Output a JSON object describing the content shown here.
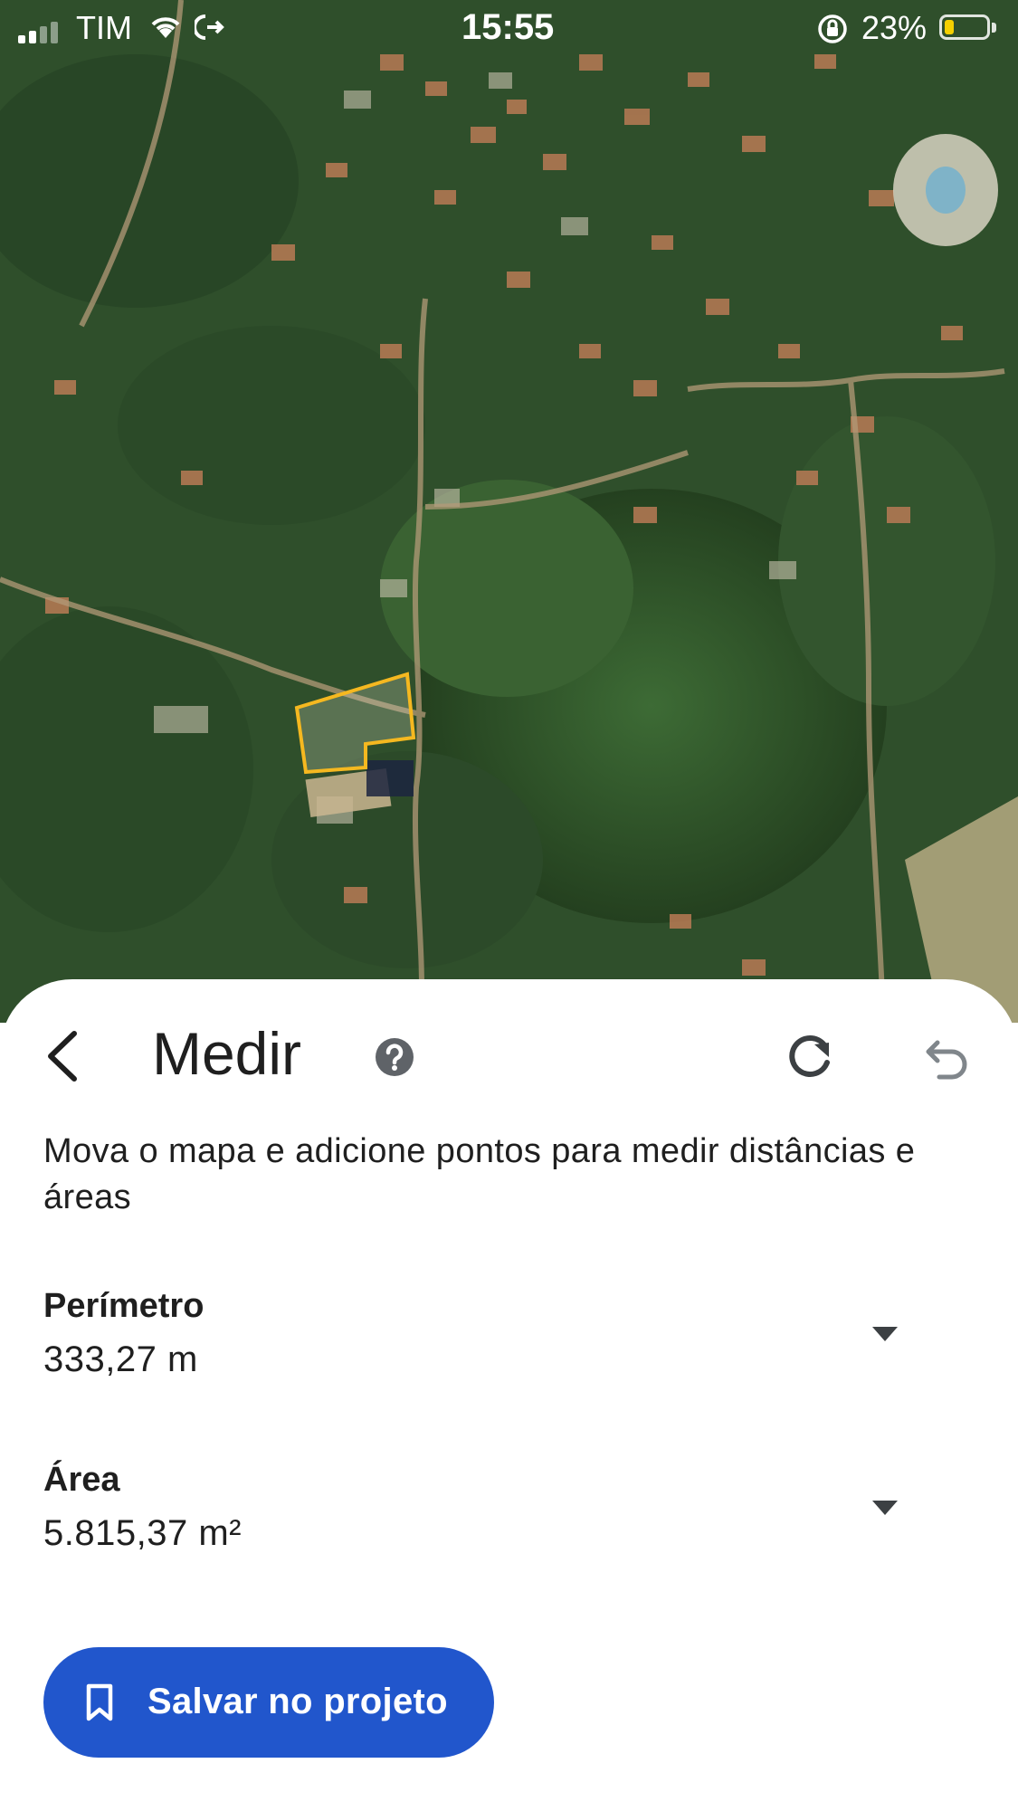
{
  "status_bar": {
    "carrier": "TIM",
    "time": "15:55",
    "battery_percent": "23%",
    "battery_level": 0.23
  },
  "map": {
    "type": "satellite",
    "measured_shape_color": "#f5b820"
  },
  "measure_panel": {
    "title": "Medir",
    "instructions": "Mova o mapa e adicione pontos para medir distâncias e áreas",
    "perimeter": {
      "label": "Perímetro",
      "value": "333,27 m"
    },
    "area": {
      "label": "Área",
      "value": "5.815,37 m²"
    },
    "save_button": {
      "label": "Salvar no projeto"
    },
    "accent_color": "#2156cc"
  }
}
